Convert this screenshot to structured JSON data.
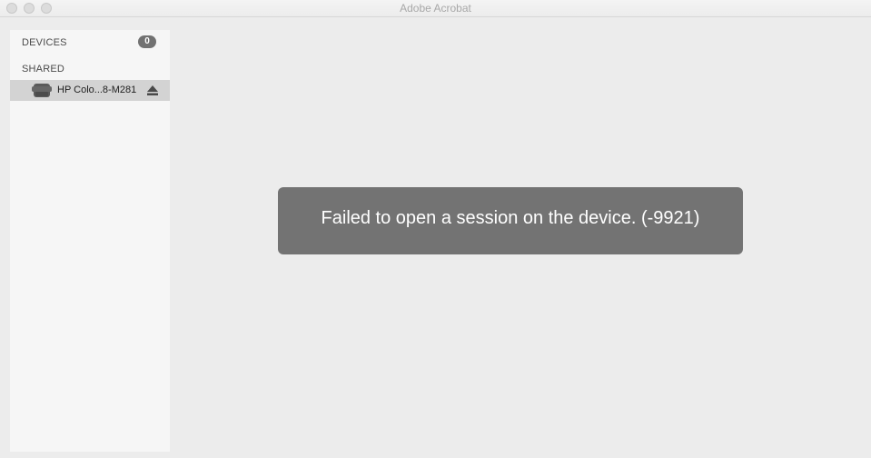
{
  "window": {
    "title": "Adobe Acrobat"
  },
  "sidebar": {
    "devices_header": "DEVICES",
    "devices_count": "0",
    "shared_header": "SHARED",
    "shared_items": [
      {
        "label": "HP Colo...8-M281",
        "icon": "printer-icon",
        "action_icon": "eject-icon"
      }
    ]
  },
  "message": {
    "text": "Failed to open a session on the device. (-9921)"
  },
  "colors": {
    "background": "#ececec",
    "sidebar": "#f6f6f6",
    "selected_row": "#d3d3d3",
    "toast": "#737373",
    "badge": "#727272"
  }
}
